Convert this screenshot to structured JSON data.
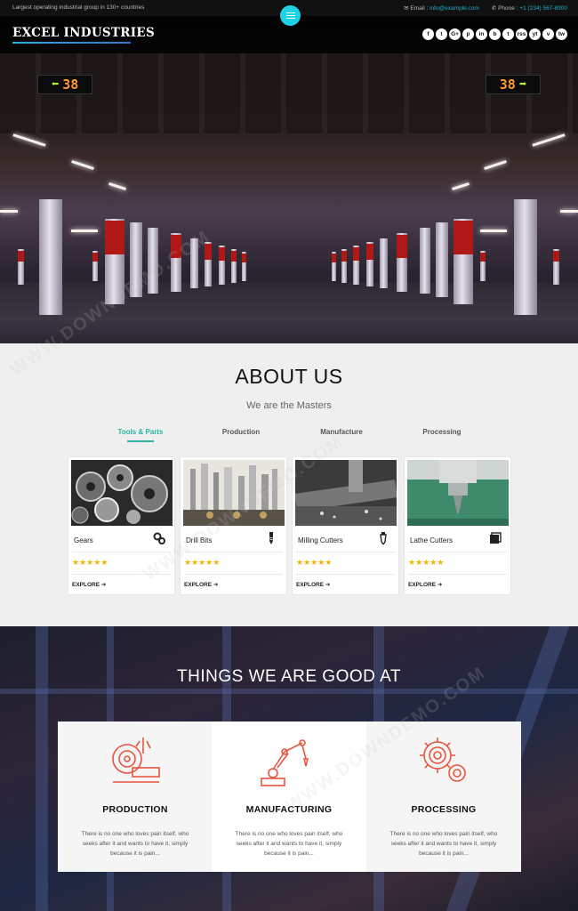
{
  "topbar": {
    "tagline": "Largest operating industrial group in 130+ countries",
    "email_label": "Email :",
    "email_value": "info@example.com",
    "phone_label": "Phone :",
    "phone_value": "+1 (234) 567-8900"
  },
  "header": {
    "logo": "EXCEL INDUSTRIES",
    "social": [
      "f",
      "t",
      "G+",
      "p",
      "in",
      "b",
      "t",
      "rss",
      "yt",
      "v",
      "tw"
    ]
  },
  "hero": {
    "sign_left_number": "38",
    "sign_right_number": "38"
  },
  "about": {
    "title": "ABOUT US",
    "subtitle": "We are the Masters",
    "tabs": [
      "Tools & Parts",
      "Production",
      "Manufacture",
      "Processing"
    ],
    "active_tab": "Tools & Parts",
    "cards": [
      {
        "name": "Gears",
        "icon": "gears-icon",
        "rating": 5,
        "cta": "EXPLORE ➜"
      },
      {
        "name": "Drill Bits",
        "icon": "drill-bit-icon",
        "rating": 5,
        "cta": "EXPLORE ➜"
      },
      {
        "name": "Milling Cutters",
        "icon": "milling-cutter-icon",
        "rating": 5,
        "cta": "EXPLORE ➜"
      },
      {
        "name": "Lathe Cutters",
        "icon": "lathe-cutter-icon",
        "rating": 5,
        "cta": "EXPLORE ➜"
      }
    ]
  },
  "good_at": {
    "title": "THINGS WE ARE GOOD AT",
    "services": [
      {
        "title": "PRODUCTION",
        "icon": "saw-blade-icon",
        "desc": "There is no one who loves pain itself, who seeks after it and wants to have it, simply because it is pain..."
      },
      {
        "title": "MANUFACTURING",
        "icon": "robot-arm-icon",
        "desc": "There is no one who loves pain itself, who seeks after it and wants to have it, simply because it is pain..."
      },
      {
        "title": "PROCESSING",
        "icon": "gear-icon",
        "desc": "There is no one who loves pain itself, who seeks after it and wants to have it, simply because it is pain..."
      }
    ]
  },
  "colors": {
    "accent": "#2bb5a0",
    "menu_button": "#1ed2e6",
    "stars": "#f6b400",
    "icon_red": "#e8553e"
  },
  "watermark": "WWW.DOWNDEMO.COM"
}
